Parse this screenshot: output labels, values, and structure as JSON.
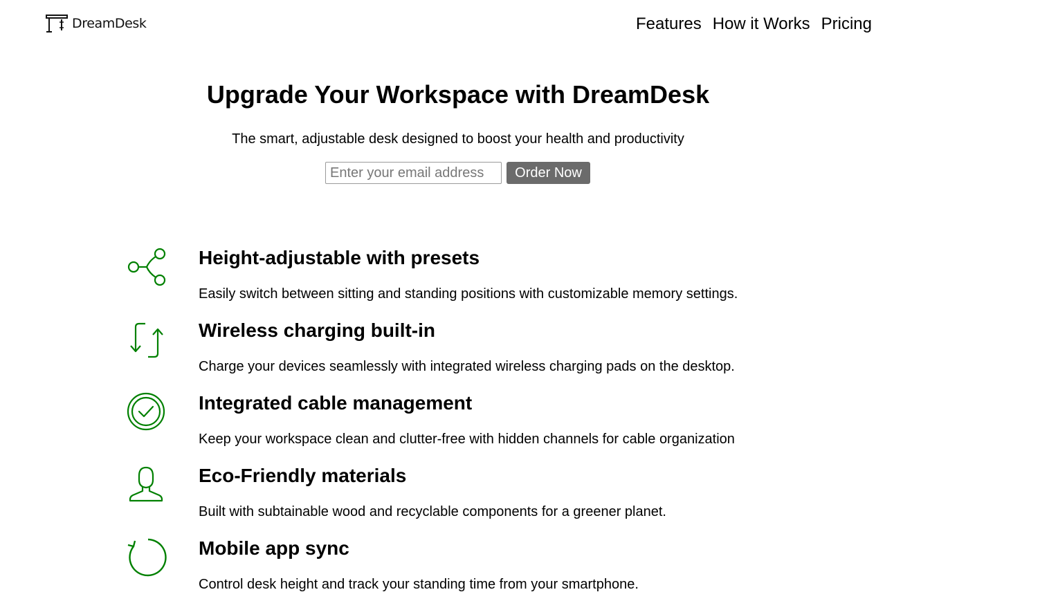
{
  "brand": {
    "name": "DreamDesk",
    "icon": "desk-logo-icon"
  },
  "nav": [
    {
      "label": "Features"
    },
    {
      "label": "How it Works"
    },
    {
      "label": "Pricing"
    }
  ],
  "hero": {
    "title": "Upgrade Your Workspace with DreamDesk",
    "subtitle": "The smart, adjustable desk designed to boost your health and productivity",
    "email_placeholder": "Enter your email address",
    "cta_label": "Order Now"
  },
  "colors": {
    "accent": "#008000",
    "button": "#6b6b6b"
  },
  "features": [
    {
      "icon": "share-icon",
      "title": "Height-adjustable with presets",
      "description": "Easily switch between sitting and standing positions with customizable memory settings."
    },
    {
      "icon": "sync-arrows-icon",
      "title": "Wireless charging built-in",
      "description": "Charge your devices seamlessly with integrated wireless charging pads on the desktop."
    },
    {
      "icon": "check-circle-icon",
      "title": "Integrated cable management",
      "description": "Keep your workspace clean and clutter-free with hidden channels for cable organization"
    },
    {
      "icon": "user-icon",
      "title": "Eco-Friendly materials",
      "description": "Built with subtainable wood and recyclable components for a greener planet."
    },
    {
      "icon": "refresh-icon",
      "title": "Mobile app sync",
      "description": "Control desk height and track your standing time from your smartphone."
    }
  ]
}
